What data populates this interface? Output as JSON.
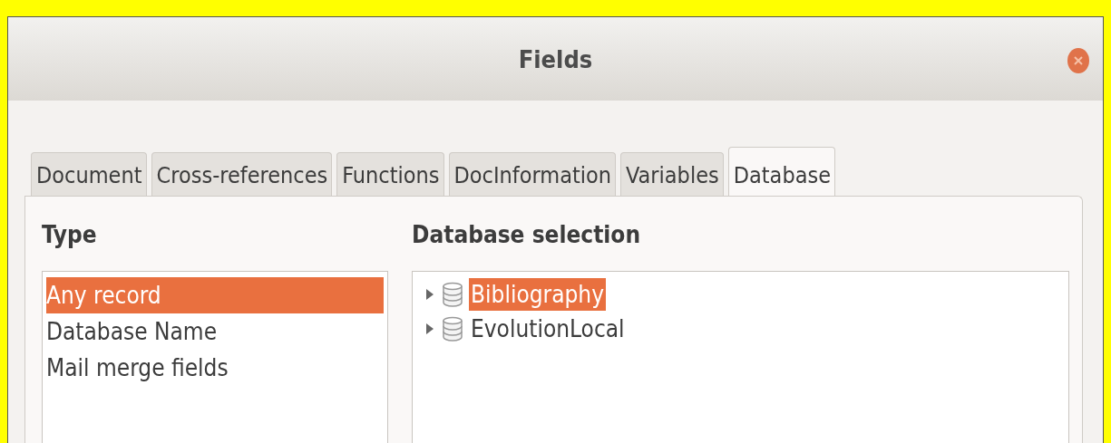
{
  "window": {
    "title": "Fields"
  },
  "tabs": [
    {
      "label": "Document",
      "selected": false
    },
    {
      "label": "Cross-references",
      "selected": false
    },
    {
      "label": "Functions",
      "selected": false
    },
    {
      "label": "DocInformation",
      "selected": false
    },
    {
      "label": "Variables",
      "selected": false
    },
    {
      "label": "Database",
      "selected": true
    }
  ],
  "type": {
    "heading": "Type",
    "items": [
      {
        "label": "Any record",
        "selected": true
      },
      {
        "label": "Database Name",
        "selected": false
      },
      {
        "label": "Mail merge fields",
        "selected": false
      }
    ]
  },
  "database_selection": {
    "heading": "Database selection",
    "items": [
      {
        "label": "Bibliography",
        "selected": true,
        "expanded": false
      },
      {
        "label": "EvolutionLocal",
        "selected": false,
        "expanded": false
      }
    ]
  }
}
